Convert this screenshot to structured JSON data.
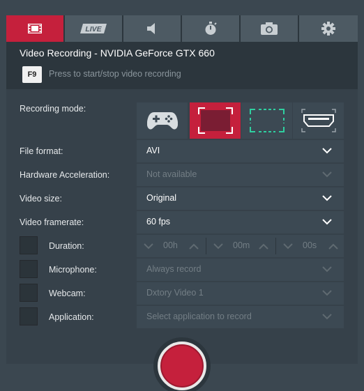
{
  "tabs": [
    {
      "name": "video-icon",
      "active": true
    },
    {
      "name": "live-icon",
      "label": "LIVE"
    },
    {
      "name": "audio-icon"
    },
    {
      "name": "benchmark-icon"
    },
    {
      "name": "screenshot-icon"
    },
    {
      "name": "settings-icon"
    }
  ],
  "header": {
    "title": "Video Recording - NVIDIA GeForce GTX 660",
    "hotkey": "F9",
    "hotkey_desc": "Press to start/stop video recording"
  },
  "recording_mode": {
    "label": "Recording mode:",
    "modes": [
      "gamepad-icon",
      "fullscreen-icon",
      "region-icon",
      "hdmi-icon"
    ],
    "active_index": 1
  },
  "file_format": {
    "label": "File format:",
    "value": "AVI"
  },
  "hw_accel": {
    "label": "Hardware Acceleration:",
    "value": "Not available"
  },
  "video_size": {
    "label": "Video size:",
    "value": "Original"
  },
  "framerate": {
    "label": "Video framerate:",
    "value": "60 fps"
  },
  "duration": {
    "label": "Duration:",
    "hours": "00h",
    "minutes": "00m",
    "seconds": "00s"
  },
  "microphone": {
    "label": "Microphone:",
    "value": "Always record"
  },
  "webcam": {
    "label": "Webcam:",
    "value": "Dxtory Video 1"
  },
  "application": {
    "label": "Application:",
    "value": "Select application to record"
  },
  "colors": {
    "accent": "#c5203c",
    "panel": "#2c363d",
    "row": "#3c4953"
  }
}
